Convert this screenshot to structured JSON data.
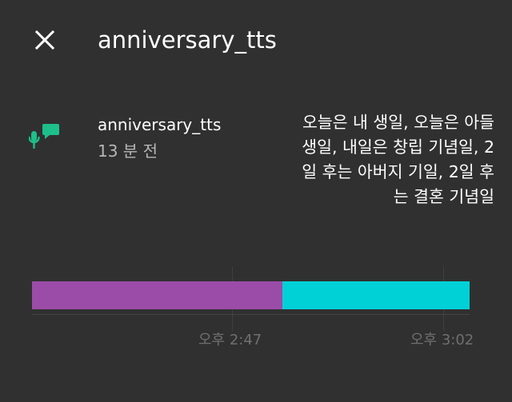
{
  "header": {
    "close_icon": "close-icon",
    "title": "anniversary_tts"
  },
  "entry": {
    "icon": "mic-chat-icon",
    "icon_color": "#1dbf8a",
    "title": "anniversary_tts",
    "time": "13 분 전",
    "message": "오늘은 내 생일, 오늘은 아들 생일, 내일은 창립 기념일, 2일 후는 아버지 기일, 2일 후는 결혼 기념일"
  },
  "timeline": {
    "segments": [
      {
        "color": "#9b4ca8",
        "fraction": 0.572
      },
      {
        "color": "#00d1d6",
        "fraction": 0.428
      }
    ],
    "ticks": [
      "오후 2:47",
      "오후 3:02"
    ]
  }
}
